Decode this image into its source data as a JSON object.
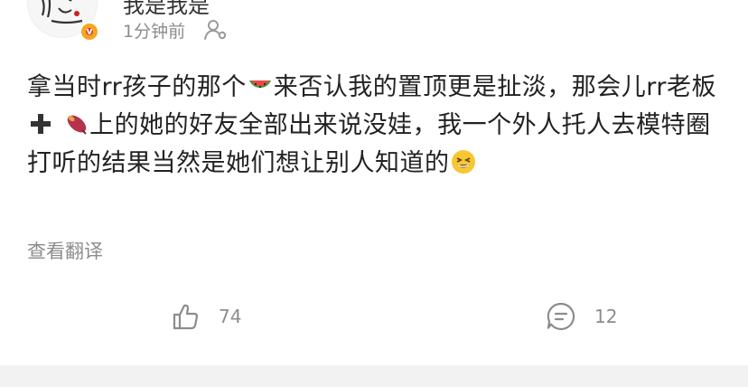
{
  "post": {
    "username": "我是我是",
    "time": "1分钟前",
    "text_parts": [
      "拿当时rr孩子的那个",
      "来否认我的置顶更是扯淡，那会儿rr老板",
      "上的她的好友全部出来说没娃，我一个外人托人去模特圈打听的结果当然是她们想让别人知道的"
    ],
    "emojis": [
      "watermelon-emoji",
      "plus-emoji",
      "sweet-potato-emoji",
      "grinning-squint-emoji"
    ],
    "translate_label": "查看翻译"
  },
  "actions": {
    "like_count": "74",
    "comment_count": "12"
  },
  "colors": {
    "text": "#222222",
    "muted": "#8c8c8c",
    "verified_badge": "#f5a623",
    "divider": "#f2f2f2"
  }
}
